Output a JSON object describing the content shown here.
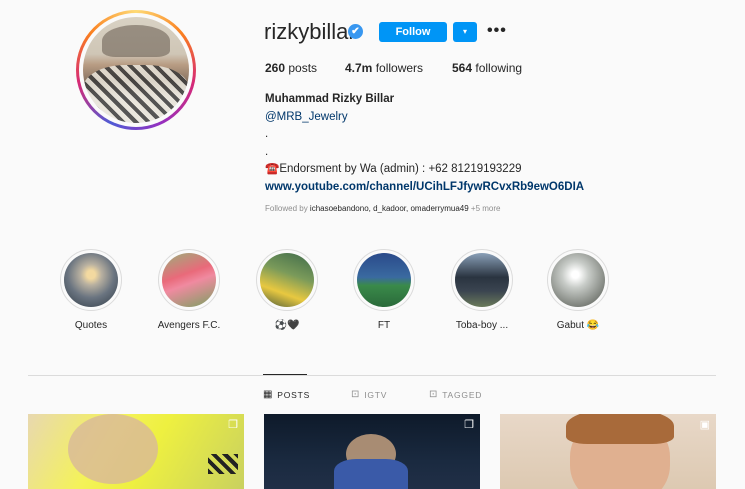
{
  "profile": {
    "username": "rizkybillar",
    "verified_icon": "✔",
    "follow_label": "Follow",
    "dropdown_icon": "▾",
    "more_icon": "•••"
  },
  "stats": {
    "posts_count": "260",
    "posts_label": "posts",
    "followers_count": "4.7m",
    "followers_label": "followers",
    "following_count": "564",
    "following_label": "following"
  },
  "bio": {
    "full_name": "Muhammad Rizky Billar",
    "mention": "@MRB_Jewelry",
    "dot1": ".",
    "dot2": ".",
    "contact": "☎️Endorsment by Wa (admin) : +62 81219193229",
    "url": "www.youtube.com/channel/UCihLFJfywRCvxRb9ewO6DIA"
  },
  "followed_by": {
    "prefix": "Followed by ",
    "names": "ichasoebandono, d_kadoor, omaderrymua49",
    "more": " +5 more"
  },
  "highlights": [
    {
      "label": "Quotes"
    },
    {
      "label": "Avengers F.C."
    },
    {
      "label": "⚽🖤"
    },
    {
      "label": "FT"
    },
    {
      "label": "Toba-boy ..."
    },
    {
      "label": "Gabut 😂"
    }
  ],
  "tabs": {
    "posts": "POSTS",
    "igtv": "IGTV",
    "tagged": "TAGGED"
  },
  "colors": {
    "accent": "#0095f6",
    "verified": "#3897f0",
    "link": "#00376b"
  }
}
